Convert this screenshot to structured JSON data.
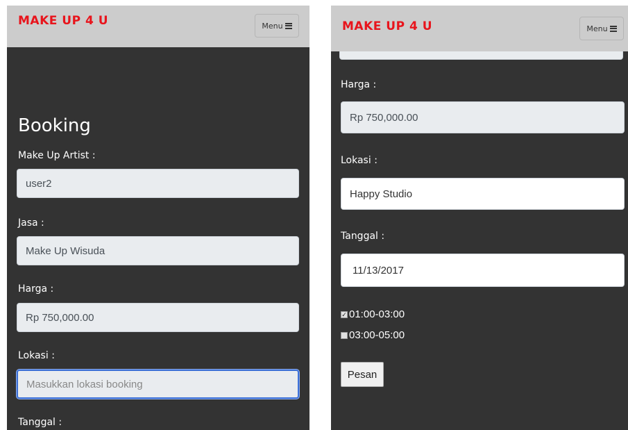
{
  "left": {
    "brand": "MAKE UP 4 U",
    "menu_label": "Menu",
    "heading": "Booking",
    "mua_label": "Make Up Artist :",
    "mua_value": "user2",
    "jasa_label": "Jasa :",
    "jasa_value": "Make Up Wisuda",
    "harga_label": "Harga :",
    "harga_value": "Rp 750,000.00",
    "lokasi_label": "Lokasi :",
    "lokasi_placeholder": "Masukkan lokasi booking",
    "tanggal_label": "Tanggal :"
  },
  "right": {
    "brand": "MAKE UP 4 U",
    "menu_label": "Menu",
    "harga_label": "Harga :",
    "harga_value": "Rp 750,000.00",
    "lokasi_label": "Lokasi :",
    "lokasi_value": "Happy Studio",
    "tanggal_label": "Tanggal :",
    "tanggal_value": "11/13/2017",
    "slots": [
      {
        "label": "01:00-03:00",
        "checked": true
      },
      {
        "label": "03:00-05:00",
        "checked": false
      }
    ],
    "submit_label": "Pesan"
  },
  "icons": {
    "menu": "hamburger-icon"
  },
  "colors": {
    "brand": "#e8141c",
    "navbar": "#cccccc",
    "background": "#333333",
    "focus": "#3b6fd6"
  }
}
